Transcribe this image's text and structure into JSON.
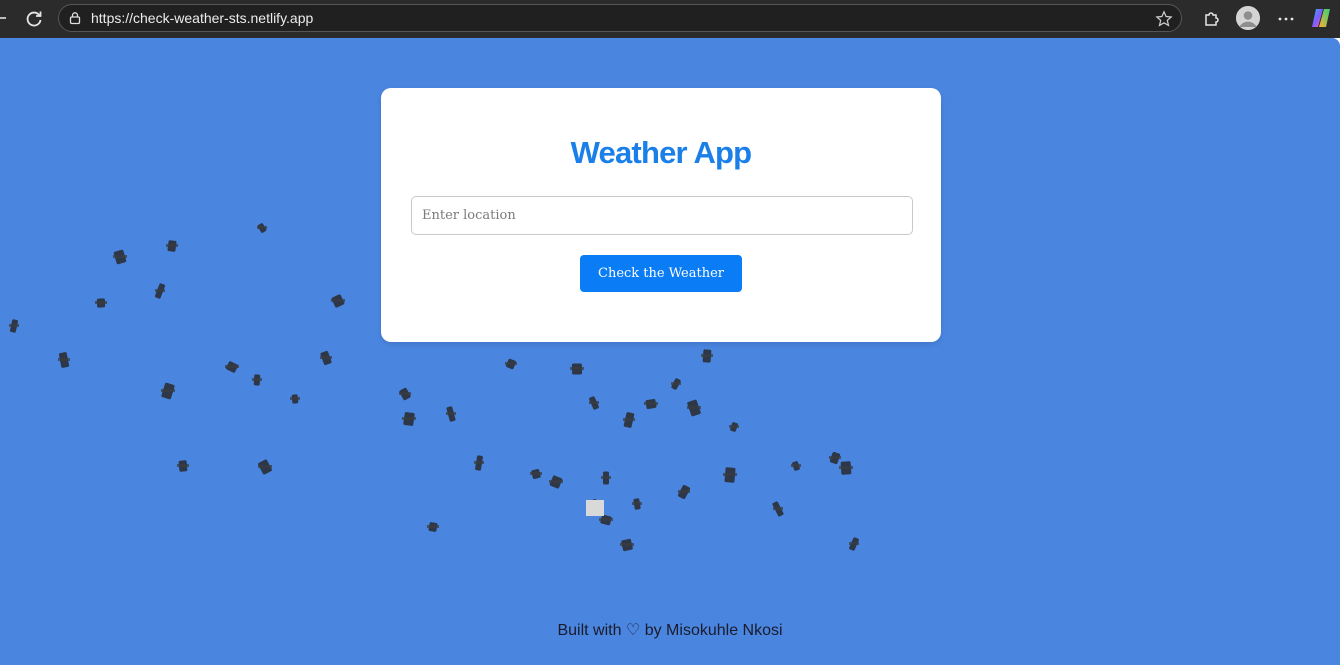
{
  "browser": {
    "url": "https://check-weather-sts.netlify.app",
    "icons": [
      "reload-icon",
      "lock-icon",
      "favorite-star-icon",
      "extensions-icon",
      "profile-avatar-icon",
      "more-menu-icon",
      "copilot-icon"
    ]
  },
  "app": {
    "title": "Weather App",
    "location_placeholder": "Enter location",
    "location_value": "",
    "check_button_label": "Check the Weather"
  },
  "footer": {
    "text": "Built with ♡ by Misokuhle Nkosi"
  },
  "colors": {
    "page_background": "#4a86e0",
    "title_color": "#1a7fe8",
    "button_color": "#0a7cf5",
    "browser_bar": "#2b2b2b"
  }
}
